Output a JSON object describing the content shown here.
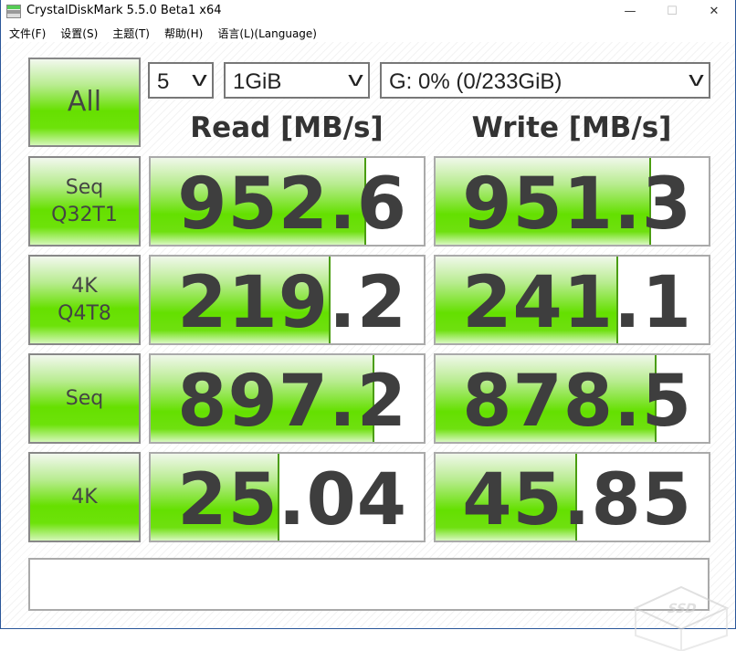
{
  "window": {
    "title": "CrystalDiskMark 5.5.0 Beta1 x64",
    "minimize": "—",
    "maximize": "☐",
    "close": "✕"
  },
  "menu": [
    "文件(F)",
    "设置(S)",
    "主题(T)",
    "帮助(H)",
    "语言(L)(Language)"
  ],
  "controls": {
    "all_label": "All",
    "count": "5",
    "size": "1GiB",
    "drive": "G: 0% (0/233GiB)"
  },
  "headers": {
    "read": "Read [MB/s]",
    "write": "Write [MB/s]"
  },
  "rows": [
    {
      "label": "Seq\nQ32T1",
      "read": "952.6",
      "write": "951.3",
      "read_fill_pct": 79,
      "write_fill_pct": 79
    },
    {
      "label": "4K\nQ4T8",
      "read": "219.2",
      "write": "241.1",
      "read_fill_pct": 66,
      "write_fill_pct": 67
    },
    {
      "label": "Seq",
      "read": "897.2",
      "write": "878.5",
      "read_fill_pct": 82,
      "write_fill_pct": 81
    },
    {
      "label": "4K",
      "read": "25.04",
      "write": "45.85",
      "read_fill_pct": 47,
      "write_fill_pct": 52
    }
  ],
  "comment": "",
  "watermark": "SSD"
}
